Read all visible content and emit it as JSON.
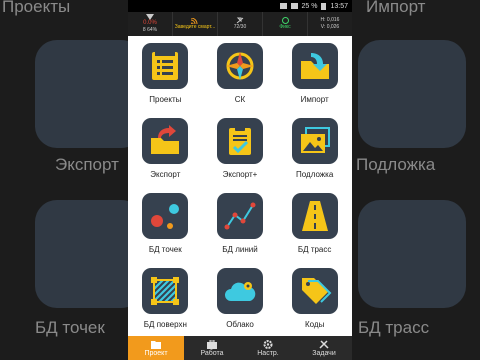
{
  "status": {
    "battery": "25 %",
    "time": "13:57"
  },
  "infobar": [
    {
      "top": "0.0%",
      "bottom": "8 64%"
    },
    {
      "top": "",
      "bottom": "Заведите смарт..."
    },
    {
      "top": "",
      "bottom": "72/30"
    },
    {
      "top": "",
      "bottom": "Фикс"
    },
    {
      "top": "H: 0,016",
      "bottom": "V: 0,026"
    }
  ],
  "tiles": [
    {
      "label": "Проекты",
      "icon": "projects-icon"
    },
    {
      "label": "СК",
      "icon": "compass-icon"
    },
    {
      "label": "Импорт",
      "icon": "import-icon"
    },
    {
      "label": "Экспорт",
      "icon": "export-icon"
    },
    {
      "label": "Экспорт+",
      "icon": "clipboard-check-icon"
    },
    {
      "label": "Подложка",
      "icon": "image-icon"
    },
    {
      "label": "БД точек",
      "icon": "points-db-icon"
    },
    {
      "label": "БД линий",
      "icon": "lines-db-icon"
    },
    {
      "label": "БД трасс",
      "icon": "road-db-icon"
    },
    {
      "label": "БД поверхн",
      "icon": "surface-db-icon"
    },
    {
      "label": "Облако",
      "icon": "cloud-icon"
    },
    {
      "label": "Коды",
      "icon": "tag-icon"
    }
  ],
  "nav": [
    {
      "label": "Проект",
      "icon": "folder-icon",
      "active": true
    },
    {
      "label": "Работа",
      "icon": "briefcase-icon",
      "active": false
    },
    {
      "label": "Настр.",
      "icon": "gear-icon",
      "active": false
    },
    {
      "label": "Задачи",
      "icon": "tools-icon",
      "active": false
    }
  ],
  "background": {
    "left_labels": [
      "Проекты",
      "Экспорт",
      "БД точек"
    ],
    "right_labels": [
      "Импорт",
      "Подложка",
      "БД трасс"
    ]
  },
  "colors": {
    "tile": "#36414f",
    "accent": "#f29a1c",
    "yellow": "#f5c518",
    "cyan": "#3ec9e0",
    "red": "#e0473a"
  }
}
